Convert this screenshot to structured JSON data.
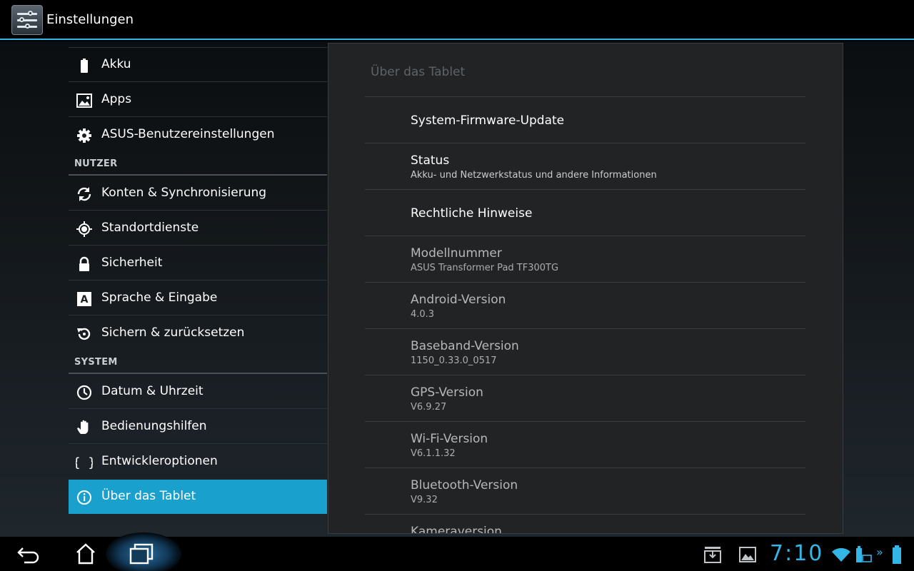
{
  "app": {
    "title": "Einstellungen"
  },
  "left_menu": {
    "items_top": [
      {
        "label": "Akku",
        "icon": "battery-icon"
      },
      {
        "label": "Apps",
        "icon": "apps-icon"
      },
      {
        "label": "ASUS-Benutzereinstellungen",
        "icon": "gear-icon"
      }
    ],
    "header_user": "NUTZER",
    "items_user": [
      {
        "label": "Konten & Synchronisierung",
        "icon": "sync-icon"
      },
      {
        "label": "Standortdienste",
        "icon": "location-icon"
      },
      {
        "label": "Sicherheit",
        "icon": "lock-icon"
      },
      {
        "label": "Sprache & Eingabe",
        "icon": "language-icon"
      },
      {
        "label": "Sichern & zurücksetzen",
        "icon": "restore-icon"
      }
    ],
    "header_system": "SYSTEM",
    "items_system": [
      {
        "label": "Datum & Uhrzeit",
        "icon": "clock-icon"
      },
      {
        "label": "Bedienungshilfen",
        "icon": "hand-icon"
      },
      {
        "label": "Entwickleroptionen",
        "icon": "braces-icon"
      },
      {
        "label": "Über das Tablet",
        "icon": "info-icon",
        "selected": true
      }
    ]
  },
  "detail": {
    "title": "Über das Tablet",
    "items": [
      {
        "title": "System-Firmware-Update",
        "summary": ""
      },
      {
        "title": "Status",
        "summary": "Akku- und Netzwerkstatus und andere Informationen"
      },
      {
        "title": "Rechtliche Hinweise",
        "summary": ""
      },
      {
        "title": "Modellnummer",
        "summary": "ASUS Transformer Pad TF300TG"
      },
      {
        "title": "Android-Version",
        "summary": "4.0.3"
      },
      {
        "title": "Baseband-Version",
        "summary": "1150_0.33.0_0517"
      },
      {
        "title": "GPS-Version",
        "summary": "V6.9.27"
      },
      {
        "title": "Wi-Fi-Version",
        "summary": "V6.1.1.32"
      },
      {
        "title": "Bluetooth-Version",
        "summary": "V9.32"
      },
      {
        "title": "Kameraversion",
        "summary": ""
      }
    ]
  },
  "system_bar": {
    "clock": "7:10",
    "accent_color": "#33b5e5",
    "selection_color": "#1aa0cc"
  }
}
